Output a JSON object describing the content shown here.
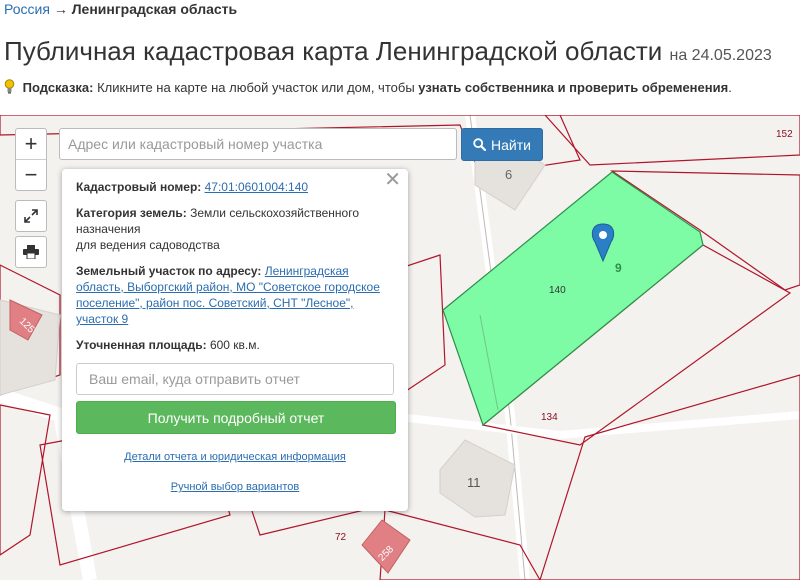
{
  "breadcrumb": {
    "root": "Россия",
    "arrow": "→",
    "current": "Ленинградская область"
  },
  "page": {
    "title": "Публичная кадастровая карта Ленинградской области",
    "date": "на 24.05.2023"
  },
  "hint": {
    "label": "Подсказка:",
    "text": " Кликните на карте на любой участок или дом, чтобы ",
    "bold": "узнать собственника и проверить обременения",
    "end": "."
  },
  "search": {
    "placeholder": "Адрес или кадастровый номер участка",
    "button": "Найти"
  },
  "zoom": {
    "in": "+",
    "out": "−"
  },
  "popup": {
    "close": "✕",
    "cad_label": "Кадастровый номер:",
    "cad_value": "47:01:0601004:140",
    "cat_label": "Категория земель:",
    "cat_value": "Земли сельскохозяйственного назначения",
    "cat_use": "для ведения садоводства",
    "addr_label": "Земельный участок по адресу:",
    "addr_value": "Ленинградская область, Выборгский район, МО \"Советское городское поселение\", район пос. Советский, СНТ \"Лесное\", участок 9",
    "area_label": "Уточненная площадь:",
    "area_value": "600 кв.м.",
    "email_placeholder": "Ваш email, куда отправить отчет",
    "report_button": "Получить подробный отчет",
    "details_link": "Детали отчета и юридическая информация",
    "manual_link": "Ручной выбор вариантов"
  },
  "map_labels": {
    "parcel_140": "140",
    "house_9": "9",
    "house_6": "6",
    "house_11": "11",
    "parcel_134": "134",
    "parcel_152": "152",
    "parcel_72": "72",
    "house_125": "125",
    "house_258": "258"
  },
  "colors": {
    "selected_parcel": "#7dfba5",
    "boundary": "#b0162b",
    "marker": "#2a7fc6",
    "primary": "#337ab7",
    "success": "#5cb85c"
  }
}
